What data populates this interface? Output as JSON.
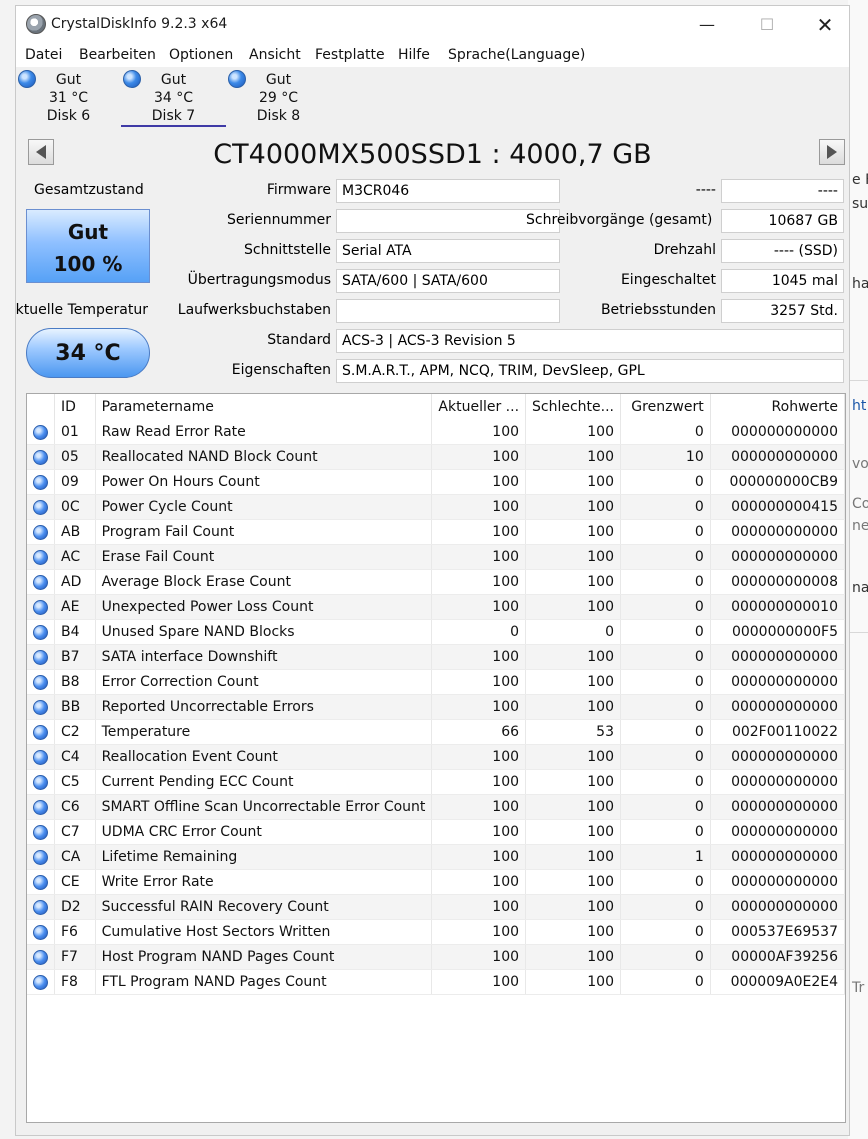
{
  "window": {
    "title": "CrystalDiskInfo 9.2.3 x64"
  },
  "menu": [
    "Datei",
    "Bearbeiten",
    "Optionen",
    "Ansicht",
    "Festplatte",
    "Hilfe",
    "Sprache(Language)"
  ],
  "disks": [
    {
      "status": "Gut",
      "temp": "31 °C",
      "name": "Disk 6"
    },
    {
      "status": "Gut",
      "temp": "34 °C",
      "name": "Disk 7"
    },
    {
      "status": "Gut",
      "temp": "29 °C",
      "name": "Disk 8"
    }
  ],
  "drive": {
    "model": "CT4000MX500SSD1 : 4000,7 GB",
    "health_label": "Gesamtzustand",
    "health_status": "Gut",
    "health_percent": "100 %",
    "temp_label": "Aktuelle Temperatur",
    "temperature": "34 °C",
    "fields": {
      "firmware_label": "Firmware",
      "firmware": "M3CR046",
      "serial_label": "Seriennummer",
      "serial": "",
      "interface_label": "Schnittstelle",
      "interface": "Serial ATA",
      "transfer_label": "Übertragungsmodus",
      "transfer": "SATA/600 | SATA/600",
      "letters_label": "Laufwerksbuchstaben",
      "letters": "",
      "standard_label": "Standard",
      "standard": "ACS-3 | ACS-3 Revision 5",
      "features_label": "Eigenschaften",
      "features": "S.M.A.R.T., APM, NCQ, TRIM, DevSleep, GPL",
      "r1_label": "----",
      "r1": "----",
      "writes_label": "Schreibvorgänge (gesamt)",
      "writes": "10687 GB",
      "rpm_label": "Drehzahl",
      "rpm": "---- (SSD)",
      "power_count_label": "Eingeschaltet",
      "power_count": "1045 mal",
      "hours_label": "Betriebsstunden",
      "hours": "3257 Std."
    }
  },
  "smart": {
    "headers": [
      "ID",
      "Parametername",
      "Aktueller ...",
      "Schlechte...",
      "Grenzwert",
      "Rohwerte"
    ],
    "rows": [
      [
        "01",
        "Raw Read Error Rate",
        "100",
        "100",
        "0",
        "000000000000"
      ],
      [
        "05",
        "Reallocated NAND Block Count",
        "100",
        "100",
        "10",
        "000000000000"
      ],
      [
        "09",
        "Power On Hours Count",
        "100",
        "100",
        "0",
        "000000000CB9"
      ],
      [
        "0C",
        "Power Cycle Count",
        "100",
        "100",
        "0",
        "000000000415"
      ],
      [
        "AB",
        "Program Fail Count",
        "100",
        "100",
        "0",
        "000000000000"
      ],
      [
        "AC",
        "Erase Fail Count",
        "100",
        "100",
        "0",
        "000000000000"
      ],
      [
        "AD",
        "Average Block Erase Count",
        "100",
        "100",
        "0",
        "000000000008"
      ],
      [
        "AE",
        "Unexpected Power Loss Count",
        "100",
        "100",
        "0",
        "000000000010"
      ],
      [
        "B4",
        "Unused Spare NAND Blocks",
        "0",
        "0",
        "0",
        "0000000000F5"
      ],
      [
        "B7",
        "SATA interface Downshift",
        "100",
        "100",
        "0",
        "000000000000"
      ],
      [
        "B8",
        "Error Correction Count",
        "100",
        "100",
        "0",
        "000000000000"
      ],
      [
        "BB",
        "Reported Uncorrectable Errors",
        "100",
        "100",
        "0",
        "000000000000"
      ],
      [
        "C2",
        "Temperature",
        "66",
        "53",
        "0",
        "002F00110022"
      ],
      [
        "C4",
        "Reallocation Event Count",
        "100",
        "100",
        "0",
        "000000000000"
      ],
      [
        "C5",
        "Current Pending ECC Count",
        "100",
        "100",
        "0",
        "000000000000"
      ],
      [
        "C6",
        "SMART Offline Scan Uncorrectable Error Count",
        "100",
        "100",
        "0",
        "000000000000"
      ],
      [
        "C7",
        "UDMA CRC Error Count",
        "100",
        "100",
        "0",
        "000000000000"
      ],
      [
        "CA",
        "Lifetime Remaining",
        "100",
        "100",
        "1",
        "000000000000"
      ],
      [
        "CE",
        "Write Error Rate",
        "100",
        "100",
        "0",
        "000000000000"
      ],
      [
        "D2",
        "Successful RAIN Recovery Count",
        "100",
        "100",
        "0",
        "000000000000"
      ],
      [
        "F6",
        "Cumulative Host Sectors Written",
        "100",
        "100",
        "0",
        "000537E69537"
      ],
      [
        "F7",
        "Host Program NAND Pages Count",
        "100",
        "100",
        "0",
        "00000AF39256"
      ],
      [
        "F8",
        "FTL Program NAND Pages Count",
        "100",
        "100",
        "0",
        "000009A0E2E4"
      ]
    ]
  },
  "background_fragments": [
    "e F",
    "su",
    "ha",
    "ht",
    "vo",
    "Co",
    "ne",
    "na",
    "Tr"
  ]
}
